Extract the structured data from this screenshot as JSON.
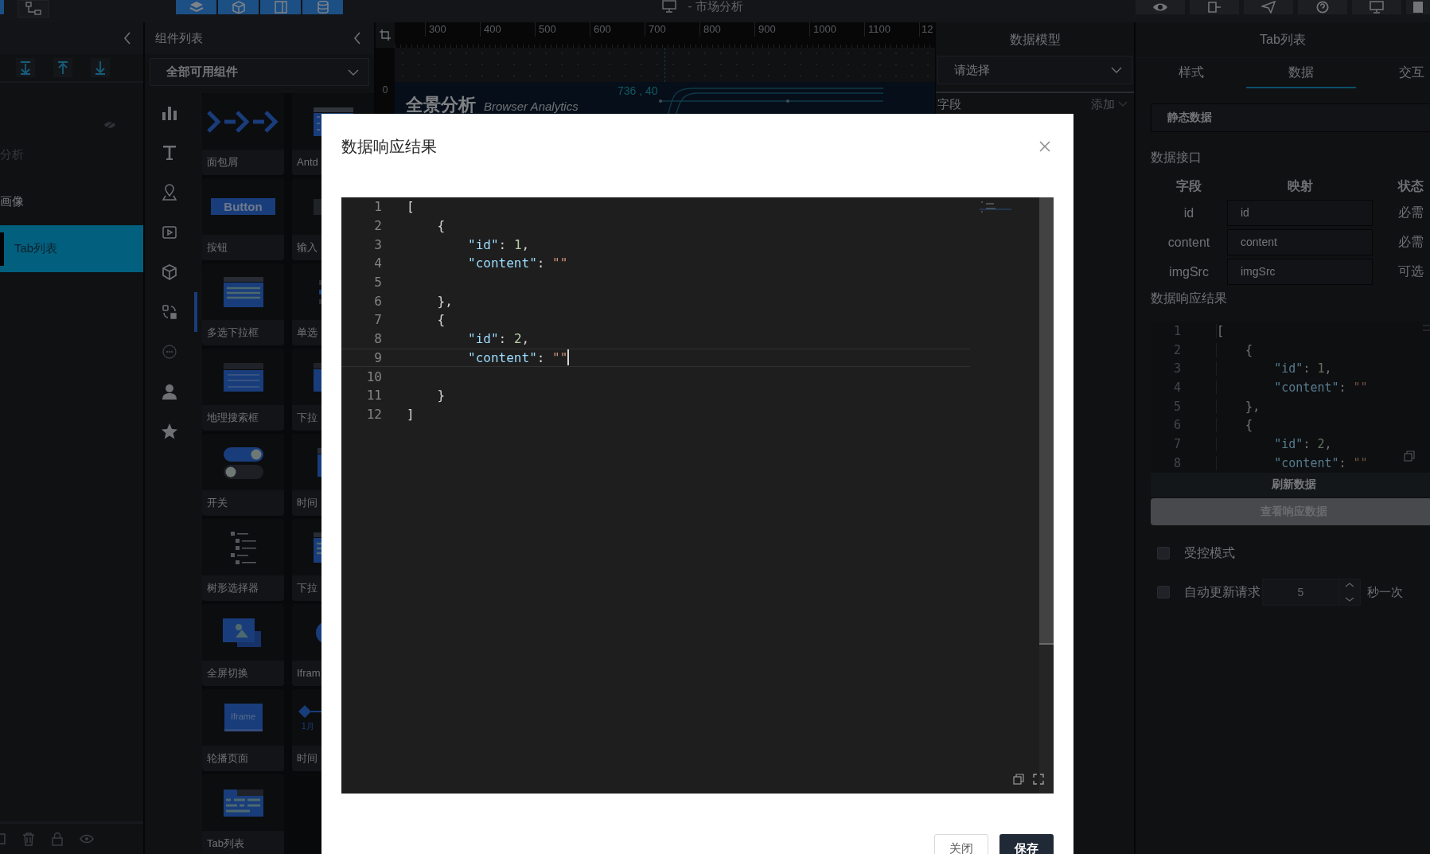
{
  "top_bar": {
    "title": "- 市场分析"
  },
  "layers_panel": {
    "items": [
      {
        "label": "分析",
        "hidden": true,
        "selected": false
      },
      {
        "label": "画像",
        "hidden": false,
        "selected": false
      },
      {
        "label": "Tab列表",
        "hidden": false,
        "selected": true
      }
    ]
  },
  "components_panel": {
    "title": "组件列表",
    "filter": "全部可用组件",
    "categories": [
      {
        "selected": false
      },
      {
        "selected": false
      },
      {
        "selected": false
      },
      {
        "selected": false
      },
      {
        "selected": false
      },
      {
        "selected": true
      },
      {
        "selected": false
      },
      {
        "selected": false
      },
      {
        "selected": false
      }
    ],
    "cards": [
      {
        "label": "面包屑",
        "kind": "breadcrumb"
      },
      {
        "label": "Antd",
        "kind": "table"
      },
      {
        "label": "按钮",
        "kind": "button",
        "thumb_text": "Button"
      },
      {
        "label": "输入",
        "kind": "input"
      },
      {
        "label": "多选下拉框",
        "kind": "multiselect"
      },
      {
        "label": "单选",
        "kind": "checklist"
      },
      {
        "label": "地理搜索框",
        "kind": "geosearch"
      },
      {
        "label": "下拉",
        "kind": "dropdown"
      },
      {
        "label": "开关",
        "kind": "switch"
      },
      {
        "label": "时间",
        "kind": "calendar"
      },
      {
        "label": "树形选择器",
        "kind": "tree"
      },
      {
        "label": "下拉",
        "kind": "multiselect"
      },
      {
        "label": "全屏切换",
        "kind": "fullscreen"
      },
      {
        "label": "Ifram",
        "kind": "circle"
      },
      {
        "label": "轮播页面",
        "kind": "carousel",
        "thumb_text": "Iframe"
      },
      {
        "label": "时间",
        "kind": "timeline",
        "thumb_text": "1月"
      },
      {
        "label": "Tab列表",
        "kind": "tabs"
      }
    ]
  },
  "canvas": {
    "ruler_marks": [
      "300",
      "400",
      "500",
      "600",
      "700",
      "800",
      "900",
      "1000",
      "1100",
      "12"
    ],
    "vertical_ruler": "0",
    "coords": "736 , 40",
    "title": "全景分析",
    "subtitle": "Browser Analytics"
  },
  "data_model_panel": {
    "title": "数据模型",
    "select_placeholder": "请选择",
    "field_label": "字段",
    "add": "添加"
  },
  "properties_panel": {
    "title": "Tab列表",
    "tabs": [
      {
        "label": "样式",
        "selected": false
      },
      {
        "label": "数据",
        "selected": true
      },
      {
        "label": "交互",
        "selected": false
      }
    ],
    "source": "静态数据",
    "interface_label": "数据接口",
    "columns": [
      "字段",
      "映射",
      "状态"
    ],
    "mappings": [
      {
        "field": "id",
        "value": "id",
        "status": "必需"
      },
      {
        "field": "content",
        "value": "content",
        "status": "必需"
      },
      {
        "field": "imgSrc",
        "value": "imgSrc",
        "status": "可选"
      }
    ],
    "result_label": "数据响应结果",
    "preview_lines": [
      {
        "number": "1",
        "text": "["
      },
      {
        "number": "2",
        "text": "    {"
      },
      {
        "number": "3",
        "text": "        \"id\": 1,"
      },
      {
        "number": "4",
        "text": "        \"content\": \"\""
      },
      {
        "number": "5",
        "text": "    },"
      },
      {
        "number": "6",
        "text": "    {"
      },
      {
        "number": "7",
        "text": "        \"id\": 2,"
      },
      {
        "number": "8",
        "text": "        \"content\": \"\""
      }
    ],
    "refresh": "刷新数据",
    "view": "查看响应数据",
    "controlled": {
      "label": "受控模式",
      "checked": false
    },
    "auto_update": {
      "label": "自动更新请求",
      "checked": false,
      "value": "5",
      "unit": "秒一次"
    }
  },
  "dialog": {
    "title": "数据响应结果",
    "lines": [
      {
        "number": "1",
        "text": "[",
        "current": false
      },
      {
        "number": "2",
        "text": "    {",
        "current": false
      },
      {
        "number": "3",
        "text": "        \"id\": 1,",
        "current": false
      },
      {
        "number": "4",
        "text": "        \"content\": \"\"",
        "current": false
      },
      {
        "number": "5",
        "current": false
      },
      {
        "number": "6",
        "text": "    },",
        "current": false
      },
      {
        "number": "7",
        "text": "    {",
        "current": false
      },
      {
        "number": "8",
        "text": "        \"id\": 2,",
        "current": false
      },
      {
        "number": "9",
        "text": "        \"content\": \"\"",
        "current": true
      },
      {
        "number": "10",
        "current": false
      },
      {
        "number": "11",
        "text": "    }",
        "current": false
      },
      {
        "number": "12",
        "text": "]",
        "current": false
      }
    ],
    "buttons": [
      {
        "label": "关闭",
        "kind": "default"
      },
      {
        "label": "保存",
        "kind": "primary"
      }
    ]
  }
}
